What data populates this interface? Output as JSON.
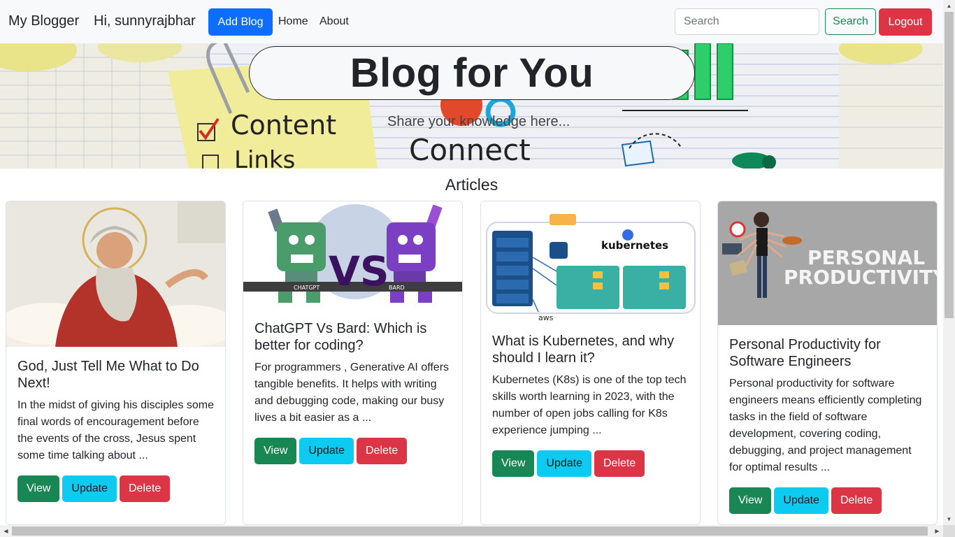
{
  "navbar": {
    "brand": "My Blogger",
    "greeting": "Hi, sunnyrajbhar",
    "add_blog_label": "Add Blog",
    "links": [
      "Home",
      "About"
    ],
    "search_placeholder": "Search",
    "search_label": "Search",
    "logout_label": "Logout"
  },
  "hero": {
    "title": "Blog for You",
    "subtitle": "Share your knowledge here..."
  },
  "articles": {
    "heading": "Articles",
    "items": [
      {
        "title": "God, Just Tell Me What to Do Next!",
        "excerpt": "In the midst of giving his disciples some final words of encouragement before the events of the cross, Jesus spent some time talking about ...",
        "image": "painting-of-bearded-man-on-clouds"
      },
      {
        "title": "ChatGPT Vs Bard: Which is better for coding?",
        "excerpt": "For programmers , Generative AI offers tangible benefits. It helps with writing and debugging code, making our busy lives a bit easier as a ...",
        "image": "chatgpt-vs-bard-robots",
        "image_labels": [
          "CHATGPT",
          "VS",
          "BARD"
        ]
      },
      {
        "title": "What is Kubernetes, and why should I learn it?",
        "excerpt": "Kubernetes (K8s) is one of the top tech skills worth learning in 2023, with the number of open jobs calling for K8s experience jumping ...",
        "image": "kubernetes-architecture-diagram",
        "image_labels": [
          "kubernetes",
          "aws"
        ]
      },
      {
        "title": "Personal Productivity for Software Engineers",
        "excerpt": "Personal productivity for software engineers means efficiently completing tasks in the field of software development, covering coding, debugging, and project management for optimal results ...",
        "image": "personal-productivity-banner",
        "image_labels": [
          "PERSONAL",
          "PRODUCTIVITY"
        ]
      }
    ],
    "view_label": "View",
    "update_label": "Update",
    "delete_label": "Delete"
  },
  "colors": {
    "primary": "#0d6efd",
    "success": "#198754",
    "info": "#0dcaf0",
    "danger": "#dc3545",
    "navbar_bg": "#f8f9fa"
  }
}
